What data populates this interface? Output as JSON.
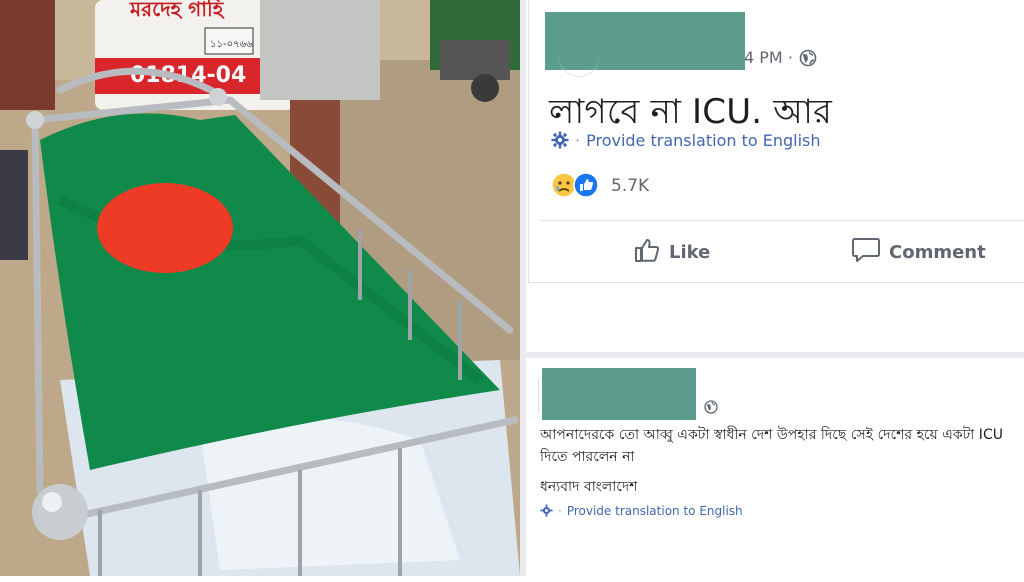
{
  "post": {
    "time": "4 PM",
    "separator": "·",
    "text": "লাগবে না ICU. আর",
    "translate_link": "Provide translation to English",
    "reaction_count": "5.7K",
    "actions": {
      "like": "Like",
      "comment": "Comment"
    }
  },
  "comment": {
    "text_line1": "আপনাদেরকে তো আব্বু একটা স্বাধীন দেশ উপহার দিছে সেই দেশের হয়ে একটা ICU দিতে পারলেন না",
    "text_line2": "ধন্যবাদ বাংলাদেশ",
    "translate_link": "Provide translation to English"
  },
  "photo": {
    "vehicle_sign_text": "মরদেহ গাহি",
    "vehicle_phone_text": "01814-04",
    "vehicle_plate_text": "১১-০৭৬৬"
  },
  "colors": {
    "redaction": "#5c9d8e",
    "link": "#4267b2",
    "flag_green": "#0f8a4a",
    "flag_red": "#ee3b25"
  },
  "icons": [
    "globe-icon",
    "gear-icon",
    "sad-reaction-icon",
    "like-reaction-icon",
    "thumbs-up-icon",
    "comment-bubble-icon"
  ]
}
